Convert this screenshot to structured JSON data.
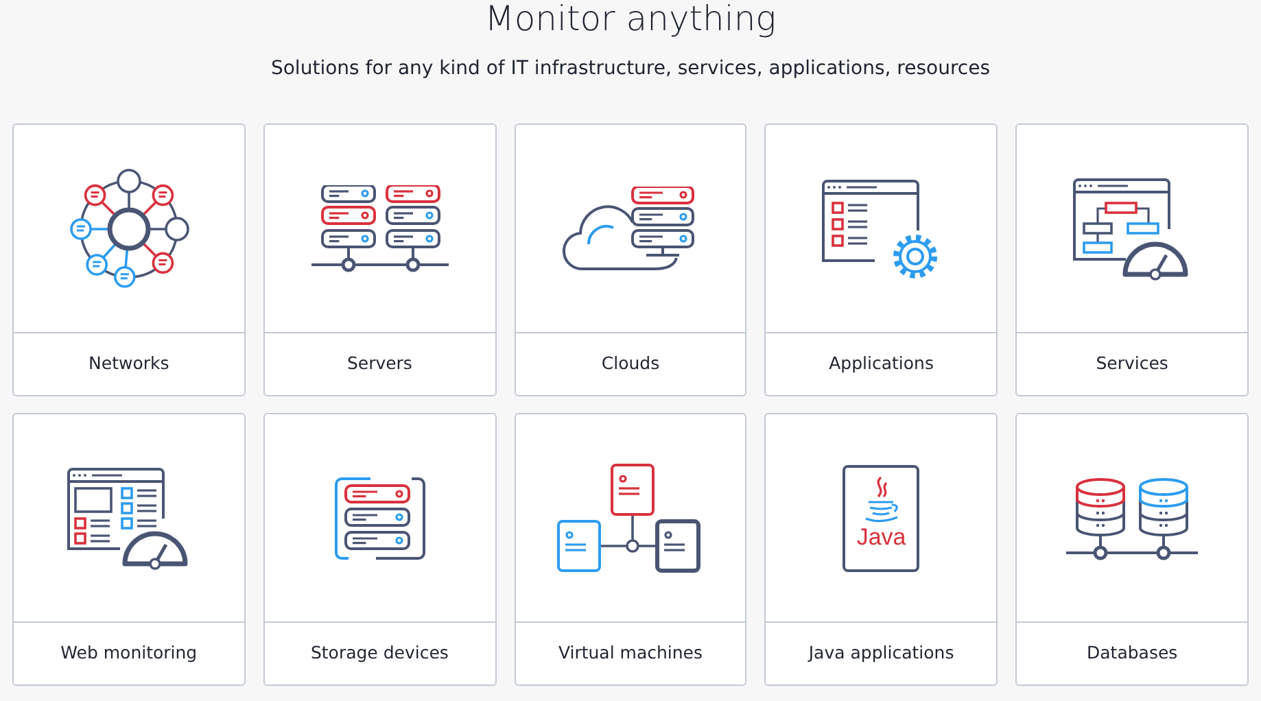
{
  "heading": "Monitor anything",
  "subheading": "Solutions for any kind of IT infrastructure, services, applications, resources",
  "tiles": [
    {
      "label": "Networks",
      "kind": "network"
    },
    {
      "label": "Servers",
      "kind": "servers"
    },
    {
      "label": "Clouds",
      "kind": "cloud"
    },
    {
      "label": "Applications",
      "kind": "applications"
    },
    {
      "label": "Services",
      "kind": "services"
    },
    {
      "label": "Web monitoring",
      "kind": "web"
    },
    {
      "label": "Storage devices",
      "kind": "storage"
    },
    {
      "label": "Virtual machines",
      "kind": "vm"
    },
    {
      "label": "Java applications",
      "kind": "java",
      "logo_text": "Java"
    },
    {
      "label": "Databases",
      "kind": "databases"
    }
  ]
}
